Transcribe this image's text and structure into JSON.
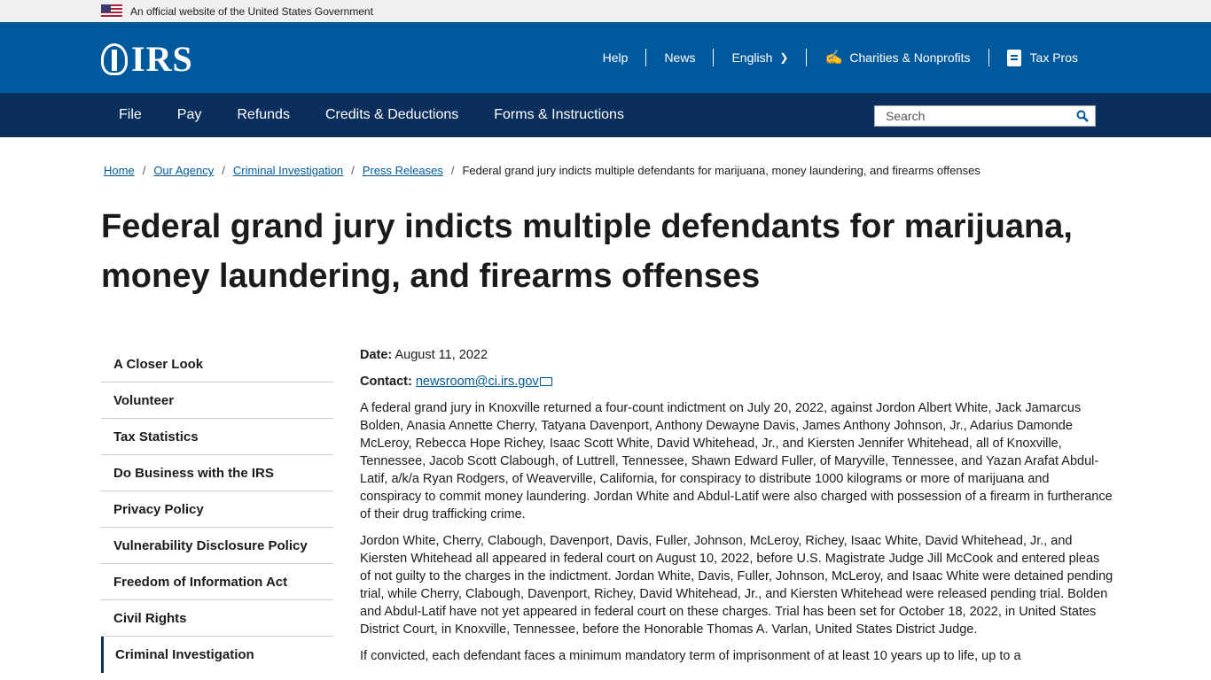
{
  "gov_banner": {
    "text": "An official website of the United States Government"
  },
  "header": {
    "logo_text": "IRS",
    "util_nav": {
      "help": "Help",
      "news": "News",
      "language": "English",
      "charities": "Charities & Nonprofits",
      "tax_pros": "Tax Pros"
    }
  },
  "main_nav": {
    "items": [
      "File",
      "Pay",
      "Refunds",
      "Credits & Deductions",
      "Forms & Instructions"
    ],
    "search_placeholder": "Search"
  },
  "breadcrumb": {
    "links": [
      "Home",
      "Our Agency",
      "Criminal Investigation",
      "Press Releases"
    ],
    "current": "Federal grand jury indicts multiple defendants for marijuana, money laundering, and firearms offenses"
  },
  "page_title": "Federal grand jury indicts multiple defendants for marijuana, money laundering, and firearms offenses",
  "sidebar": {
    "items": [
      "A Closer Look",
      "Volunteer",
      "Tax Statistics",
      "Do Business with the IRS",
      "Privacy Policy",
      "Vulnerability Disclosure Policy",
      "Freedom of Information Act",
      "Civil Rights",
      "Criminal Investigation"
    ]
  },
  "article": {
    "date_label": "Date:",
    "date_value": "August 11, 2022",
    "contact_label": "Contact:",
    "contact_email": "newsroom@ci.irs.gov",
    "paragraphs": [
      "A federal grand jury in Knoxville returned a four-count indictment on July 20, 2022, against Jordon Albert White, Jack Jamarcus Bolden, Anasia Annette Cherry, Tatyana Davenport, Anthony Dewayne Davis, James Anthony Johnson, Jr., Adarius Damonde McLeroy, Rebecca Hope Richey, Isaac Scott White, David Whitehead, Jr., and Kiersten Jennifer Whitehead, all of Knoxville, Tennessee, Jacob Scott Clabough, of Luttrell, Tennessee, Shawn Edward Fuller, of Maryville, Tennessee, and Yazan Arafat Abdul-Latif, a/k/a Ryan Rodgers, of Weaverville, California, for conspiracy to distribute 1000 kilograms or more of marijuana and conspiracy to commit money laundering. Jordan White and Abdul-Latif were also charged with possession of a firearm in furtherance of their drug trafficking crime.",
      "Jordon White, Cherry, Clabough, Davenport, Davis, Fuller, Johnson, McLeroy, Richey, Isaac White, David Whitehead, Jr., and Kiersten Whitehead all appeared in federal court on August 10, 2022, before U.S. Magistrate Judge Jill McCook and entered pleas of not guilty to the charges in the indictment. Jordan White, Davis, Fuller, Johnson, McLeroy, and Isaac White were detained pending trial, while Cherry, Clabough, Davenport, Richey, David Whitehead, Jr., and Kiersten Whitehead were released pending trial. Bolden and Abdul-Latif have not yet appeared in federal court on these charges. Trial has been set for October 18, 2022, in United States District Court, in Knoxville, Tennessee, before the Honorable Thomas A. Varlan, United States District Judge.",
      "If convicted, each defendant faces a minimum mandatory term of imprisonment of at least 10 years up to life, up to a"
    ]
  }
}
